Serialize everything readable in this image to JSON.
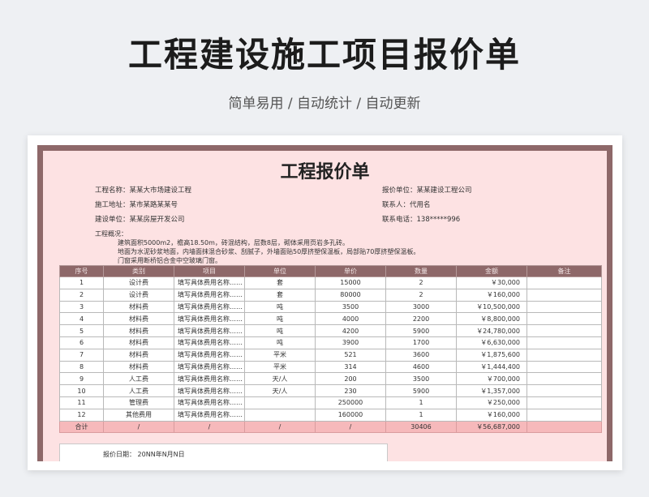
{
  "header": {
    "title": "工程建设施工项目报价单",
    "subtitle": "简单易用 / 自动统计 / 自动更新"
  },
  "sheet": {
    "title": "工程报价单",
    "info_left": [
      {
        "label": "工程名称：",
        "value": "某某大市场建设工程"
      },
      {
        "label": "施工地址：",
        "value": "某市某路某某号"
      },
      {
        "label": "建设单位：",
        "value": "某某房屋开发公司"
      }
    ],
    "info_right": [
      {
        "label": "报价单位：",
        "value": "某某建设工程公司"
      },
      {
        "label": "联系人：",
        "value": "代用名"
      },
      {
        "label": "联系电话：",
        "value": "138*****996"
      }
    ],
    "overview_label": "工程概况：",
    "overview_lines": [
      "建筑面积5000m2，檐高18.50m，砖混结构，层数8层，砌体采用页岩多孔砖。",
      "地面为水泥砂浆地面，内墙面抹混合砂浆、刮腻子，外墙面贴50厚挤塑保温板，局部贴70厚挤塑保温板。",
      "门窗采用断桥铝合金中空玻璃门窗。"
    ],
    "columns": [
      "序号",
      "类别",
      "项目",
      "单位",
      "单价",
      "数量",
      "金额",
      "备注"
    ],
    "rows": [
      [
        "1",
        "设计费",
        "填写具体费用名称……",
        "套",
        "15000",
        "2",
        "￥30,000",
        ""
      ],
      [
        "2",
        "设计费",
        "填写具体费用名称……",
        "套",
        "80000",
        "2",
        "￥160,000",
        ""
      ],
      [
        "3",
        "材料费",
        "填写具体费用名称……",
        "吨",
        "3500",
        "3000",
        "￥10,500,000",
        ""
      ],
      [
        "4",
        "材料费",
        "填写具体费用名称……",
        "吨",
        "4000",
        "2200",
        "￥8,800,000",
        ""
      ],
      [
        "5",
        "材料费",
        "填写具体费用名称……",
        "吨",
        "4200",
        "5900",
        "￥24,780,000",
        ""
      ],
      [
        "6",
        "材料费",
        "填写具体费用名称……",
        "吨",
        "3900",
        "1700",
        "￥6,630,000",
        ""
      ],
      [
        "7",
        "材料费",
        "填写具体费用名称……",
        "平米",
        "521",
        "3600",
        "￥1,875,600",
        ""
      ],
      [
        "8",
        "材料费",
        "填写具体费用名称……",
        "平米",
        "314",
        "4600",
        "￥1,444,400",
        ""
      ],
      [
        "9",
        "人工费",
        "填写具体费用名称……",
        "天/人",
        "200",
        "3500",
        "￥700,000",
        ""
      ],
      [
        "10",
        "人工费",
        "填写具体费用名称……",
        "天/人",
        "230",
        "5900",
        "￥1,357,000",
        ""
      ],
      [
        "11",
        "管理费",
        "填写具体费用名称……",
        "",
        "250000",
        "1",
        "￥250,000",
        ""
      ],
      [
        "12",
        "其他费用",
        "填写具体费用名称……",
        "",
        "160000",
        "1",
        "￥160,000",
        ""
      ]
    ],
    "total_row": [
      "合计",
      "/",
      "/",
      "/",
      "/",
      "30406",
      "￥56,687,000",
      ""
    ],
    "quote_date": "报价日期：  20NN年N月N日"
  },
  "colors": {
    "header_bar": "#8e6869",
    "sheet_bg": "#fde2e3",
    "total_row": "#f6b9bb"
  }
}
